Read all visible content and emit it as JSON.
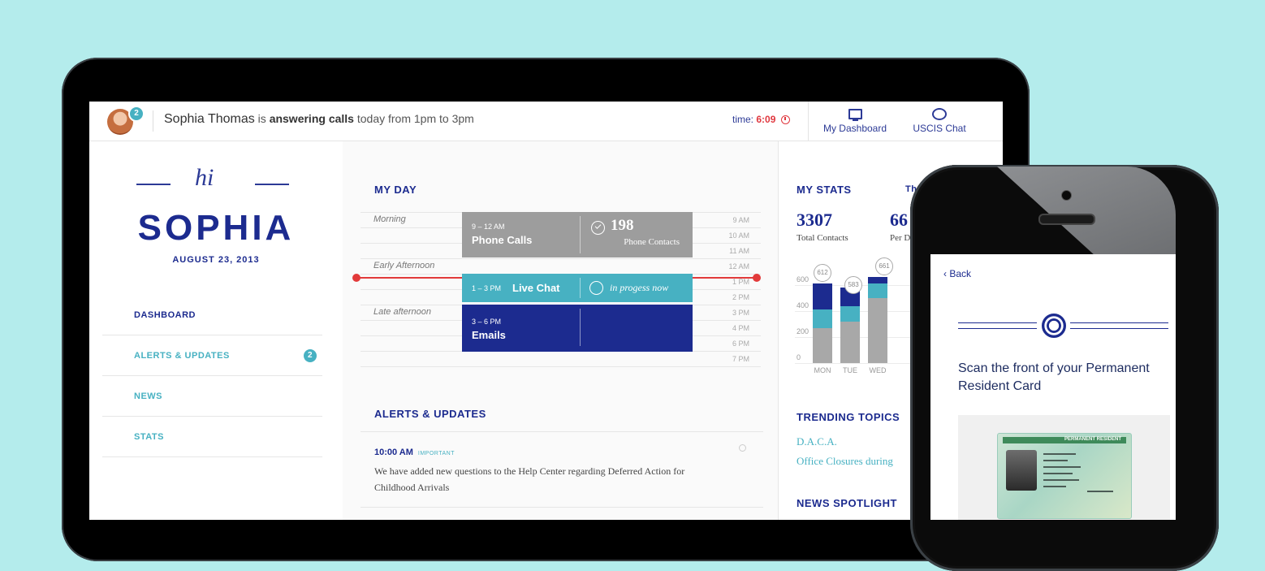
{
  "header": {
    "avatar_badge": "2",
    "user_name": "Sophia Thomas",
    "status_prefix": "is",
    "status_bold": "answering calls",
    "status_suffix": "today from 1pm to 3pm",
    "time_label": "time:",
    "time_value": "6:09",
    "nav": [
      {
        "label": "My Dashboard",
        "icon": "monitor-icon"
      },
      {
        "label": "USCIS Chat",
        "icon": "chat-icon"
      }
    ]
  },
  "sidebar": {
    "greeting": "hi",
    "name": "SOPHIA",
    "date": "AUGUST 23, 2013",
    "menu": [
      {
        "label": "DASHBOARD"
      },
      {
        "label": "ALERTS & UPDATES",
        "badge": "2"
      },
      {
        "label": "NEWS"
      },
      {
        "label": "STATS"
      }
    ]
  },
  "my_day": {
    "title": "MY DAY",
    "periods": [
      "Morning",
      "Early Afternoon",
      "Late afternoon"
    ],
    "hours": [
      "9 AM",
      "10 AM",
      "11 AM",
      "12 AM",
      "1 PM",
      "2 PM",
      "3 PM",
      "4 PM",
      "6 PM",
      "7 PM"
    ],
    "blocks": [
      {
        "time": "9 – 12 AM",
        "title": "Phone Calls",
        "count": "198",
        "count_label": "Phone Contacts",
        "color": "#9d9d9d"
      },
      {
        "time": "1 – 3 PM",
        "title": "Live Chat",
        "status": "in progess now",
        "color": "#47b1c2"
      },
      {
        "time": "3 – 6 PM",
        "title": "Emails",
        "color": "#1c2b8f"
      }
    ]
  },
  "alerts": {
    "title": "ALERTS & UPDATES",
    "items": [
      {
        "time": "10:00 AM",
        "tag": "IMPORTANT",
        "text": "We have added new questions to the Help Center regarding Deferred Action for Childhood Arrivals"
      }
    ]
  },
  "stats": {
    "title": "MY STATS",
    "tab_partial": "Th",
    "total_value": "3307",
    "total_label": "Total Contacts",
    "second_value": "66",
    "second_label": "Per D",
    "chart_data": {
      "type": "bar",
      "stacked": true,
      "categories": [
        "MON",
        "TUE",
        "WED"
      ],
      "totals": [
        "612",
        "583",
        "661"
      ],
      "y_ticks": [
        "600",
        "400",
        "200",
        "0"
      ],
      "ylim": [
        0,
        700
      ],
      "series": [
        {
          "values": [
            270,
            320,
            500
          ],
          "color": "#a8a8a8"
        },
        {
          "values": [
            140,
            120,
            110
          ],
          "color": "#47b1c2"
        },
        {
          "values": [
            202,
            143,
            51
          ],
          "color": "#1c2b8f"
        }
      ]
    }
  },
  "trending": {
    "title": "TRENDING TOPICS",
    "items": [
      "D.A.C.A.",
      "Office Closures during"
    ]
  },
  "news": {
    "title": "NEWS SPOTLIGHT"
  },
  "phone": {
    "back_label": "Back",
    "instruction": "Scan the front of your Permanent Resident Card",
    "card_header": "PERMANENT RESIDENT"
  },
  "colors": {
    "background": "#b4ecec",
    "navy": "#1c2b8f",
    "teal": "#47b1c2",
    "red": "#e23a3a"
  }
}
